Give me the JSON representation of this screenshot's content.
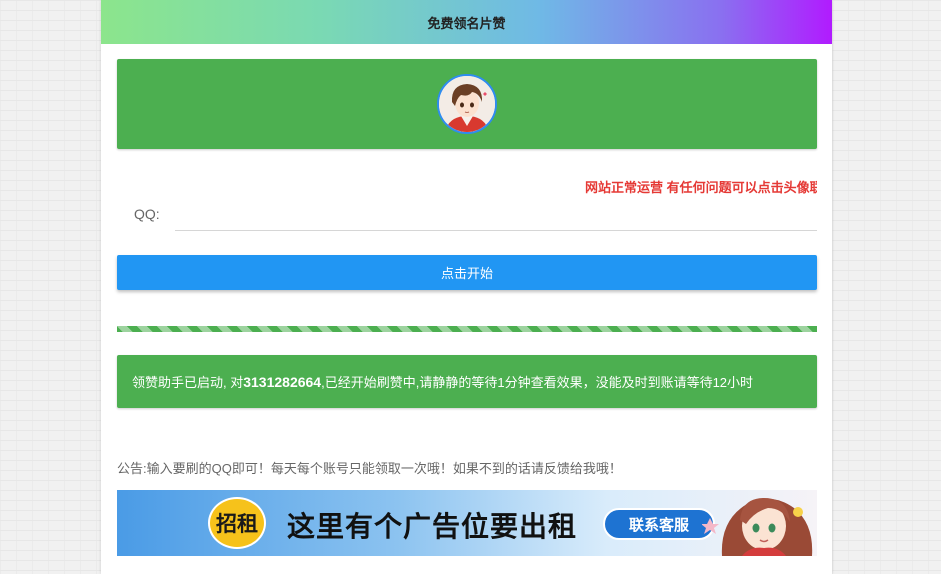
{
  "header": {
    "title": "免费领名片赞"
  },
  "banner": {
    "avatar_icon": "anime-boy-avatar"
  },
  "marquee": {
    "text": "网站正常运营 有任何问题可以点击头像联"
  },
  "form": {
    "qq_label": "QQ:",
    "qq_value": "",
    "qq_placeholder": "",
    "start_label": "点击开始"
  },
  "progress": {
    "percent": 100,
    "color": "#4caf50"
  },
  "status": {
    "prefix": "领赞助手已启动, 对",
    "qq_number": "3131282664",
    "suffix": ",已经开始刷赞中,请静静的等待1分钟查看效果，没能及时到账请等待12小时"
  },
  "notice": {
    "text": "公告:输入要刷的QQ即可！每天每个账号只能领取一次哦！如果不到的话请反馈给我哦！"
  },
  "ad": {
    "badge": "招租",
    "headline": "这里有个广告位要出租",
    "button": "联系客服",
    "illustration_icon": "anime-girl-illustration"
  },
  "colors": {
    "accent_green": "#4caf50",
    "primary_blue": "#2196f3",
    "alert_red": "#e53935"
  }
}
